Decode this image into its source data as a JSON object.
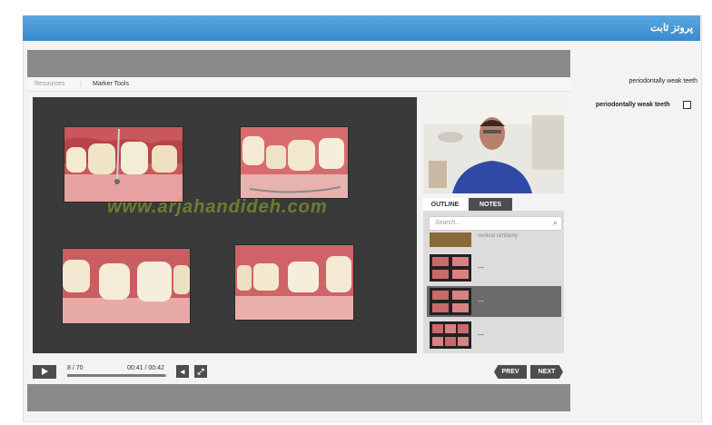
{
  "window": {
    "title": "پروتز ثابت"
  },
  "toolbar_tabs": {
    "resources": "Resources",
    "marker_tools": "Marker Tools"
  },
  "slide": {
    "watermark": "www.arjahandideh.com"
  },
  "panel": {
    "tabs": [
      {
        "label": "OUTLINE"
      },
      {
        "label": "NOTES"
      }
    ],
    "search_placeholder": "Search...",
    "items": [
      {
        "label": "vertical similarity"
      },
      {
        "label": "---"
      },
      {
        "label": "---"
      },
      {
        "label": "---"
      }
    ]
  },
  "player": {
    "slide_counter": "8 / 70",
    "time": "00:41 / 00:42",
    "prev_label": "PREV",
    "next_label": "NEXT",
    "progress_fraction": 0.98
  },
  "side_notes": {
    "label": "periodontally weak teeth",
    "checkbox_label": "periodontally weak teeth"
  },
  "colors": {
    "title_bar": "#3a89cc",
    "selected_item": "#6b6b6b"
  }
}
